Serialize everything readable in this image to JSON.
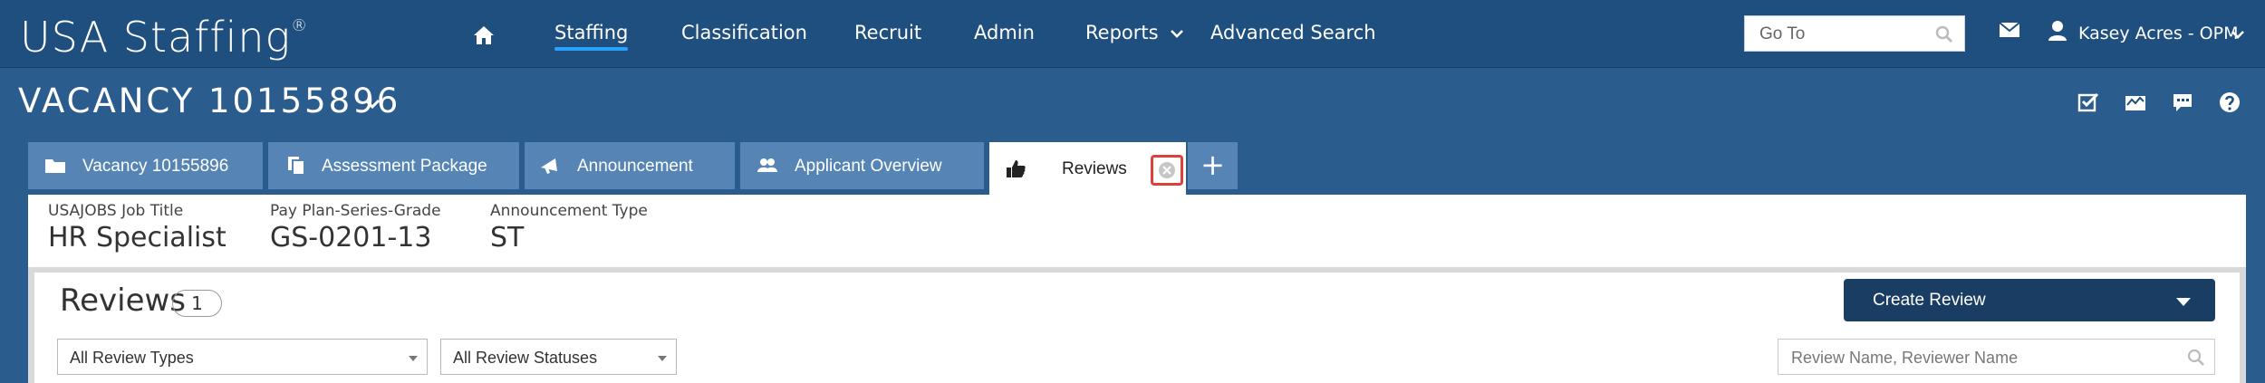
{
  "topnav": {
    "logo_text": "USA Staffing",
    "logo_mark": "®",
    "home_icon": "home-icon",
    "items": [
      {
        "label": "Staffing",
        "active": true
      },
      {
        "label": "Classification"
      },
      {
        "label": "Recruit"
      },
      {
        "label": "Admin"
      },
      {
        "label": "Reports"
      },
      {
        "label": "Advanced Search"
      }
    ],
    "goto_placeholder": "Go To",
    "user_name": "Kasey Acres - OPM"
  },
  "vacancy": {
    "title": "VACANCY 10155896"
  },
  "header_icons": [
    "checkbox-icon",
    "dashboard-icon",
    "comment-icon",
    "help-icon"
  ],
  "tabs": [
    {
      "label": "Vacancy 10155896",
      "icon": "folder-icon"
    },
    {
      "label": "Assessment Package",
      "icon": "documents-icon"
    },
    {
      "label": "Announcement",
      "icon": "megaphone-icon"
    },
    {
      "label": "Applicant Overview",
      "icon": "users-icon"
    },
    {
      "label": "Reviews",
      "icon": "thumbs-up-icon",
      "active": true
    }
  ],
  "add_tab_label": "+",
  "info": {
    "job_title_label": "USAJOBS Job Title",
    "job_title_value": "HR Specialist",
    "pay_plan_label": "Pay Plan-Series-Grade",
    "pay_plan_value": "GS-0201-13",
    "announcement_type_label": "Announcement Type",
    "announcement_type_value": "ST"
  },
  "reviews": {
    "title": "Reviews",
    "count": "1",
    "create_button": "Create Review",
    "type_filter": "All Review Types",
    "status_filter": "All Review Statuses",
    "search_placeholder": "Review Name, Reviewer Name"
  },
  "colors": {
    "nav_bg": "#1f4f7e",
    "header_bg": "#2a5d8e",
    "tab_bg": "#5685b5",
    "accent": "#2aa2ff",
    "button_bg": "#1a3e63",
    "close_highlight": "#e0403a"
  }
}
